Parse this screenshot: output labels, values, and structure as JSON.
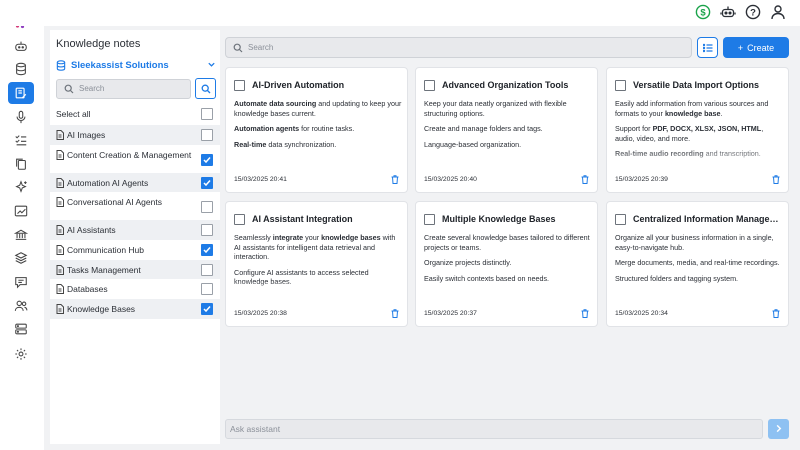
{
  "header": {
    "icons": [
      "dollar-icon",
      "robot-icon",
      "help-icon",
      "user-icon"
    ]
  },
  "rail": {
    "items": [
      "bot-icon",
      "database-icon",
      "knowledge-icon",
      "mic-icon",
      "tasks-icon",
      "copy-icon",
      "sparkle-icon",
      "chart-icon",
      "library-icon",
      "layers-icon",
      "chat-icon",
      "users-icon",
      "server-icon",
      "settings-icon"
    ],
    "active_index": 2
  },
  "knowledge": {
    "title": "Knowledge notes",
    "org": "Sleekassist Solutions",
    "search_placeholder": "Search",
    "select_all": "Select all",
    "items": [
      {
        "label": "AI Images",
        "checked": false
      },
      {
        "label": "Content Creation & Management",
        "checked": true
      },
      {
        "label": "Automation AI Agents",
        "checked": true
      },
      {
        "label": "Conversational AI Agents",
        "checked": false
      },
      {
        "label": "AI Assistants",
        "checked": false
      },
      {
        "label": "Communication Hub",
        "checked": true
      },
      {
        "label": "Tasks Management",
        "checked": false
      },
      {
        "label": "Databases",
        "checked": false
      },
      {
        "label": "Knowledge Bases",
        "checked": true
      }
    ]
  },
  "main": {
    "search_placeholder": "Search",
    "create_label": "Create",
    "assistant_placeholder": "Ask assistant"
  },
  "cards": [
    {
      "title": "AI-Driven Automation",
      "p1": {
        "b1": "Automate data sourcing",
        "t1": " and updating to keep your knowledge bases current."
      },
      "p2": {
        "b1": "Automation agents",
        "t1": " for routine tasks."
      },
      "p3": {
        "b1": "Real-time",
        "t1": " data synchronization."
      },
      "date": "15/03/2025 20:41"
    },
    {
      "title": "Advanced Organization Tools",
      "p1": {
        "b1": "",
        "t1": "Keep your data neatly organized with flexible structuring options."
      },
      "p2": {
        "b1": "",
        "t1": "Create and manage folders and tags."
      },
      "p3": {
        "b1": "",
        "t1": "Language-based organization."
      },
      "date": "15/03/2025 20:40"
    },
    {
      "title": "Versatile Data Import Options",
      "p1": {
        "b1": "",
        "t1": "Easily add information from various sources and formats to your ",
        "b2": "knowledge base",
        "t2": "."
      },
      "p2": {
        "b1": "",
        "t1": "Support for ",
        "b2": "PDF, DOCX, XLSX, JSON, HTML",
        "t2": ", audio, video, and more."
      },
      "p3": {
        "b1": "Real-time audio recording",
        "t1": " and transcription."
      },
      "date": "15/03/2025 20:39"
    },
    {
      "title": "AI Assistant Integration",
      "p1": {
        "b1": "",
        "t1": "Seamlessly ",
        "b2": "integrate",
        "t2": " your ",
        "b3": "knowledge bases",
        "t3": " with AI assistants for intelligent data retrieval and interaction."
      },
      "p2": {
        "b1": "",
        "t1": "Configure AI assistants to access selected knowledge bases."
      },
      "p3": {
        "b1": "",
        "t1": ""
      },
      "date": "15/03/2025 20:38"
    },
    {
      "title": "Multiple Knowledge Bases",
      "p1": {
        "b1": "",
        "t1": "Create several knowledge bases tailored to different projects or teams."
      },
      "p2": {
        "b1": "",
        "t1": "Organize projects distinctly."
      },
      "p3": {
        "b1": "",
        "t1": "Easily switch contexts based on needs."
      },
      "date": "15/03/2025 20:37"
    },
    {
      "title": "Centralized Information Manage…",
      "p1": {
        "b1": "",
        "t1": "Organize all your business information in a single, easy-to-navigate hub."
      },
      "p2": {
        "b1": "",
        "t1": "Merge documents, media, and real-time recordings."
      },
      "p3": {
        "b1": "",
        "t1": "Structured folders and tagging system."
      },
      "date": "15/03/2025 20:34"
    }
  ],
  "colors": {
    "accent": "#1e7be6",
    "send_disabled": "#8ec1f2",
    "dollar": "#1aa34a"
  }
}
